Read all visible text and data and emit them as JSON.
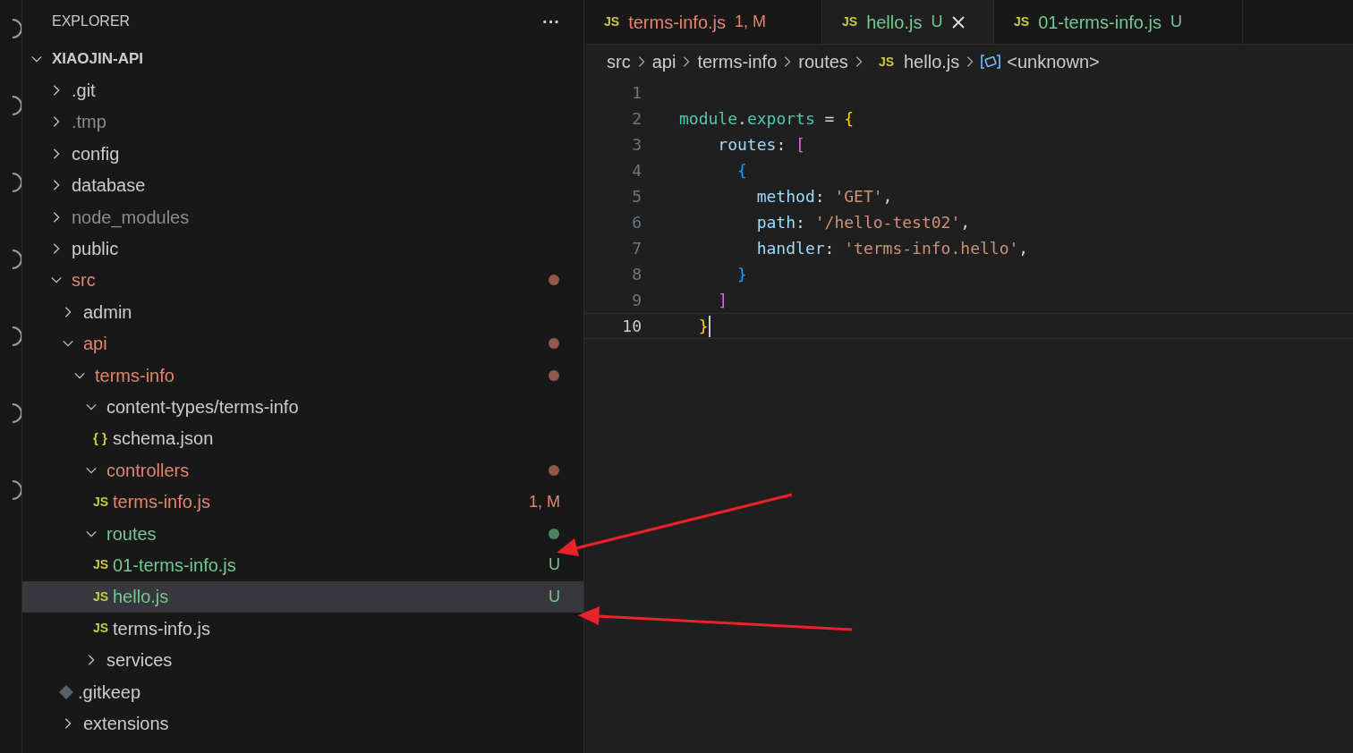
{
  "sidebar": {
    "title": "EXPLORER",
    "more": "···",
    "root": {
      "name": "XIAOJIN-API",
      "expanded": true
    },
    "tree": [
      {
        "name": ".git",
        "kind": "folder",
        "expanded": false,
        "color": "#cccccc"
      },
      {
        "name": ".tmp",
        "kind": "folder",
        "expanded": false,
        "color": "#8c8c8c"
      },
      {
        "name": "config",
        "kind": "folder",
        "expanded": false,
        "color": "#cccccc"
      },
      {
        "name": "database",
        "kind": "folder",
        "expanded": false,
        "color": "#cccccc"
      },
      {
        "name": "node_modules",
        "kind": "folder",
        "expanded": false,
        "color": "#8c8c8c"
      },
      {
        "name": "public",
        "kind": "folder",
        "expanded": false,
        "color": "#cccccc"
      },
      {
        "name": "src",
        "kind": "folder",
        "expanded": true,
        "color": "#e2846e",
        "dot": true,
        "children": [
          {
            "name": "admin",
            "kind": "folder",
            "expanded": false,
            "color": "#cccccc"
          },
          {
            "name": "api",
            "kind": "folder",
            "expanded": true,
            "color": "#e2846e",
            "dot": true,
            "children": [
              {
                "name": "terms-info",
                "kind": "folder",
                "expanded": true,
                "color": "#e2846e",
                "dot": true,
                "children": [
                  {
                    "name": "content-types/terms-info",
                    "kind": "folder",
                    "expanded": true,
                    "color": "#cccccc",
                    "children": [
                      {
                        "name": "schema.json",
                        "kind": "json",
                        "color": "#cccccc",
                        "icon": "{ }"
                      }
                    ]
                  },
                  {
                    "name": "controllers",
                    "kind": "folder",
                    "expanded": true,
                    "color": "#e2846e",
                    "dot": true,
                    "children": [
                      {
                        "name": "terms-info.js",
                        "kind": "js",
                        "color": "#e2846e",
                        "icon": "JS",
                        "badge": "1, M"
                      }
                    ]
                  },
                  {
                    "name": "routes",
                    "kind": "folder",
                    "expanded": true,
                    "color": "#73c991",
                    "dot": true,
                    "children": [
                      {
                        "name": "01-terms-info.js",
                        "kind": "js",
                        "color": "#73c991",
                        "icon": "JS",
                        "badge": "U",
                        "selected": false
                      },
                      {
                        "name": "hello.js",
                        "kind": "js",
                        "color": "#73c991",
                        "icon": "JS",
                        "badge": "U",
                        "selected": true
                      },
                      {
                        "name": "terms-info.js",
                        "kind": "js",
                        "color": "#cccccc",
                        "icon": "JS",
                        "selected": false
                      }
                    ]
                  },
                  {
                    "name": "services",
                    "kind": "folder",
                    "expanded": false,
                    "color": "#cccccc"
                  }
                ]
              }
            ]
          },
          {
            "name": ".gitkeep",
            "kind": "gitkeep",
            "color": "#cccccc"
          },
          {
            "name": "extensions",
            "kind": "folder",
            "expanded": false,
            "color": "#cccccc"
          }
        ]
      }
    ]
  },
  "tabs": [
    {
      "icon": "JS",
      "name": "terms-info.js",
      "badge": "1, M",
      "color": "#e2846e",
      "selected": false
    },
    {
      "icon": "JS",
      "name": "hello.js",
      "badge": "U",
      "color": "#73c991",
      "selected": true
    },
    {
      "icon": "JS",
      "name": "01-terms-info.js",
      "badge": "U",
      "color": "#73c991",
      "selected": false
    }
  ],
  "breadcrumb": [
    {
      "kind": "folder",
      "text": "src"
    },
    {
      "kind": "folder",
      "text": "api"
    },
    {
      "kind": "folder",
      "text": "terms-info"
    },
    {
      "kind": "folder",
      "text": "routes"
    },
    {
      "kind": "js",
      "icon": "JS",
      "text": "hello.js"
    },
    {
      "kind": "symbol",
      "text": "<unknown>"
    }
  ],
  "editor": {
    "lines": [
      {
        "number": "1",
        "current": false
      },
      {
        "number": "2",
        "current": false,
        "tokens": [
          {
            "text": "module",
            "kind": "var"
          },
          {
            "text": ".",
            "kind": "punct"
          },
          {
            "text": "exports",
            "kind": "var"
          },
          {
            "text": " = ",
            "kind": "punct"
          },
          {
            "text": "{",
            "kind": "bracket1"
          }
        ]
      },
      {
        "number": "3",
        "current": false,
        "tokens": [
          {
            "text": "    routes",
            "kind": "prop"
          },
          {
            "text": ": ",
            "kind": "punct"
          },
          {
            "text": "[",
            "kind": "bracket2"
          }
        ]
      },
      {
        "number": "4",
        "current": false,
        "tokens": [
          {
            "text": "      {",
            "kind": "bracket3"
          }
        ]
      },
      {
        "number": "5",
        "current": false,
        "tokens": [
          {
            "text": "        method",
            "kind": "prop"
          },
          {
            "text": ": ",
            "kind": "punct"
          },
          {
            "text": "'GET'",
            "kind": "string"
          },
          {
            "text": ",",
            "kind": "punct"
          }
        ]
      },
      {
        "number": "6",
        "current": false,
        "tokens": [
          {
            "text": "        path",
            "kind": "prop"
          },
          {
            "text": ": ",
            "kind": "punct"
          },
          {
            "text": "'/hello-test02'",
            "kind": "string"
          },
          {
            "text": ",",
            "kind": "punct"
          }
        ]
      },
      {
        "number": "7",
        "current": false,
        "tokens": [
          {
            "text": "        handler",
            "kind": "prop"
          },
          {
            "text": ": ",
            "kind": "punct"
          },
          {
            "text": "'terms-info.hello'",
            "kind": "string"
          },
          {
            "text": ",",
            "kind": "punct"
          }
        ]
      },
      {
        "number": "8",
        "current": false,
        "tokens": [
          {
            "text": "      }",
            "kind": "bracket3"
          }
        ]
      },
      {
        "number": "9",
        "current": false,
        "tokens": [
          {
            "text": "    ]",
            "kind": "bracket2"
          }
        ]
      },
      {
        "number": "10",
        "current": true,
        "tokens": [
          {
            "text": "  }",
            "kind": "bracket1"
          }
        ]
      }
    ]
  }
}
